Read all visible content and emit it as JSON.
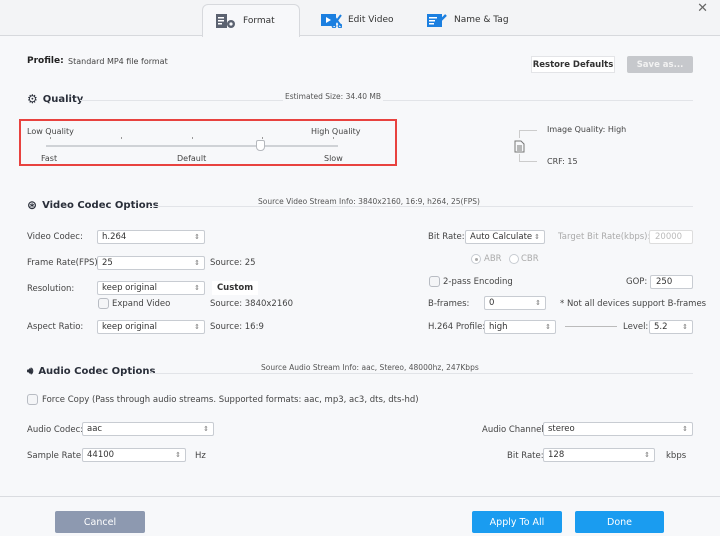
{
  "tabs": [
    {
      "label": "Format",
      "icon": "format-settings-icon",
      "active": true
    },
    {
      "label": "Edit Video",
      "icon": "edit-video-icon",
      "active": false
    },
    {
      "label": "Name & Tag",
      "icon": "name-tag-icon",
      "active": false
    }
  ],
  "close_glyph": "✕",
  "profile": {
    "label": "Profile:",
    "value": "Standard MP4 file format"
  },
  "buttons": {
    "restore_defaults": "Restore Defaults",
    "save_as": "Save as...",
    "custom": "Custom",
    "cancel": "Cancel",
    "apply_to_all": "Apply To All",
    "done": "Done"
  },
  "quality": {
    "title": "Quality",
    "estimated_size": "Estimated Size: 34.40 MB",
    "low_label": "Low Quality",
    "high_label": "High Quality",
    "fast_label": "Fast",
    "default_label": "Default",
    "slow_label": "Slow",
    "slider_value": 0.75,
    "image_quality": "Image Quality: High",
    "crf": "CRF: 15"
  },
  "video": {
    "title": "Video Codec Options",
    "source_info": "Source Video Stream Info: 3840x2160, 16:9, h264, 25(FPS)",
    "codec_label": "Video Codec:",
    "codec_value": "h.264",
    "fps_label": "Frame Rate(FPS):",
    "fps_value": "25",
    "fps_source": "Source: 25",
    "resolution_label": "Resolution:",
    "resolution_value": "keep original",
    "resolution_source": "Source: 3840x2160",
    "expand_video": "Expand Video",
    "aspect_label": "Aspect Ratio:",
    "aspect_value": "keep original",
    "aspect_source": "Source: 16:9",
    "bitrate_label": "Bit Rate:",
    "bitrate_value": "Auto Calculate",
    "target_bitrate_label": "Target Bit Rate(kbps):",
    "target_bitrate_value": "20000",
    "abr": "ABR",
    "cbr": "CBR",
    "two_pass": "2-pass Encoding",
    "gop_label": "GOP:",
    "gop_value": "250",
    "bframes_label": "B-frames:",
    "bframes_value": "0",
    "bframes_note": "* Not all devices support B-frames",
    "profile_label": "H.264 Profile:",
    "profile_value": "high",
    "level_label": "Level:",
    "level_value": "5.2"
  },
  "audio": {
    "title": "Audio Codec Options",
    "source_info": "Source Audio Stream Info: aac, Stereo, 48000hz, 247Kbps",
    "force_copy": "Force Copy (Pass through audio streams. Supported formats: aac, mp3, ac3, dts, dts-hd)",
    "codec_label": "Audio Codec:",
    "codec_value": "aac",
    "sample_label": "Sample Rate:",
    "sample_value": "44100",
    "sample_unit": "Hz",
    "channel_label": "Audio Channel:",
    "channel_value": "stereo",
    "bitrate_label": "Bit Rate:",
    "bitrate_value": "128",
    "bitrate_unit": "kbps"
  },
  "select_arrow": "⇕",
  "colors": {
    "accent": "#1a9cf0",
    "cancel": "#8d99b0",
    "highlight": "#e8423f"
  }
}
